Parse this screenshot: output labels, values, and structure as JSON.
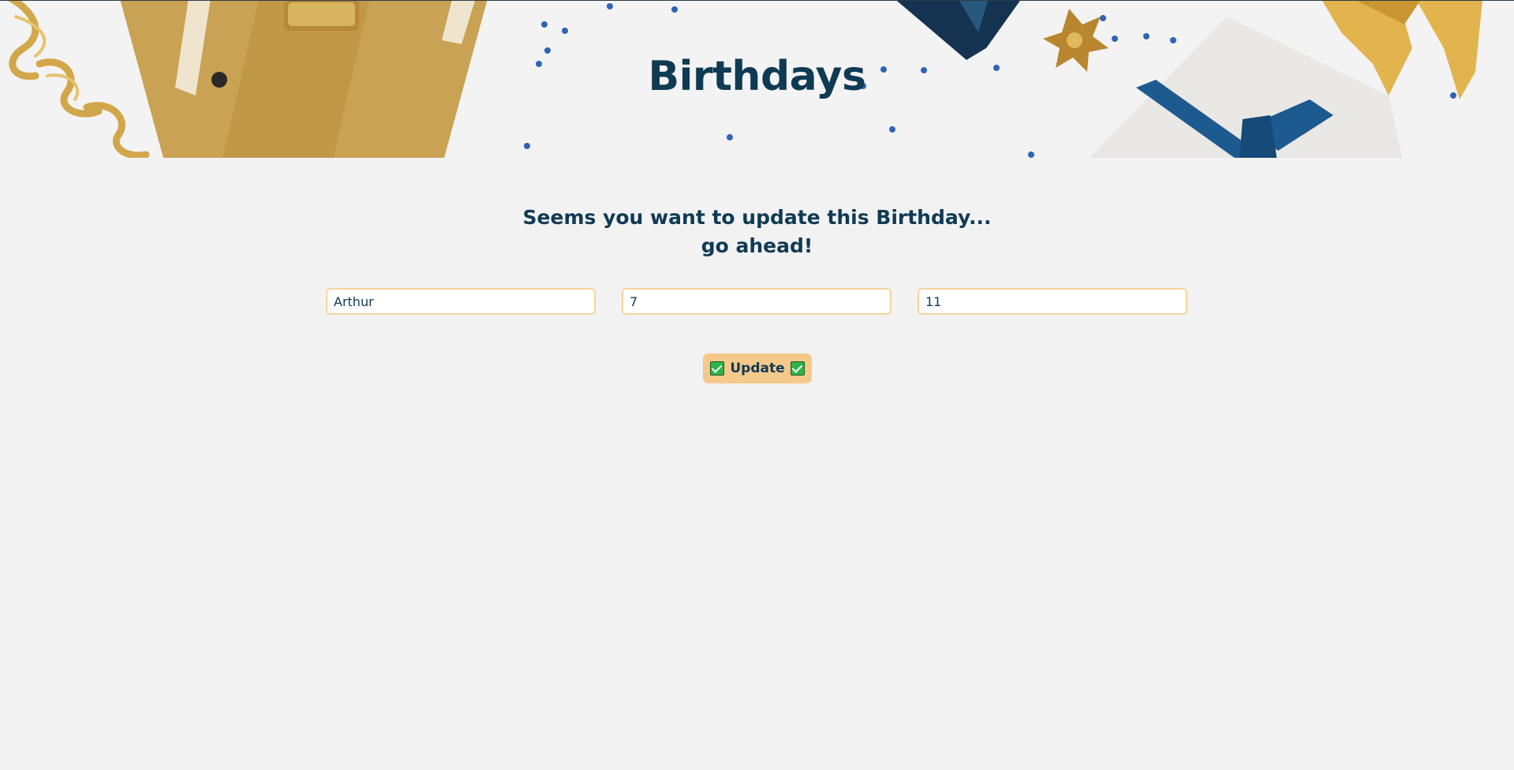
{
  "header": {
    "title": "Birthdays"
  },
  "main": {
    "subtitle_line1": "Seems you want to update this Birthday...",
    "subtitle_line2": "go ahead!",
    "form": {
      "name_value": "Arthur",
      "day_value": "7",
      "month_value": "11",
      "update_label": "Update",
      "update_icon": "check-mark-button-icon"
    }
  },
  "colors": {
    "primary_text": "#0f3a54",
    "button_bg": "#f5c98a",
    "input_border": "#f4d49a",
    "page_bg": "#f3f2f2"
  }
}
